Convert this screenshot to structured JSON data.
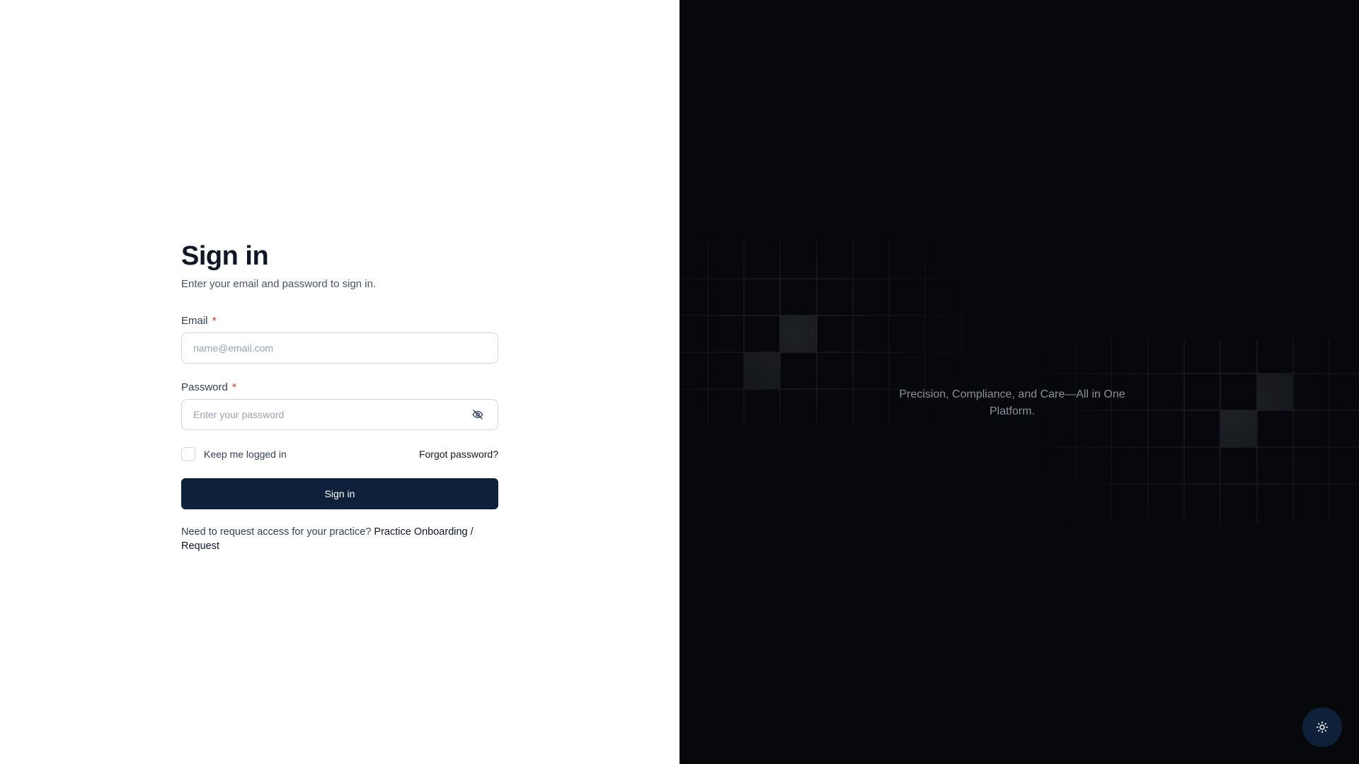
{
  "signin": {
    "title": "Sign in",
    "subtitle": "Enter your email and password to sign in.",
    "email": {
      "label": "Email",
      "required_mark": "*",
      "placeholder": "name@email.com",
      "value": ""
    },
    "password": {
      "label": "Password",
      "required_mark": "*",
      "placeholder": "Enter your password",
      "value": ""
    },
    "remember_label": "Keep me logged in",
    "remember_checked": false,
    "forgot_label": "Forgot password?",
    "submit_label": "Sign in",
    "request_text": "Need to request access for your practice?",
    "request_link": "Practice Onboarding / Request"
  },
  "hero": {
    "tagline": "Precision, Compliance, and Care—All in One Platform.",
    "background_color": "#06080c"
  },
  "theme_toggle": {
    "icon": "sun-icon"
  },
  "colors": {
    "primary": "#0f213a",
    "required": "#d92d20",
    "text": "#101828"
  }
}
